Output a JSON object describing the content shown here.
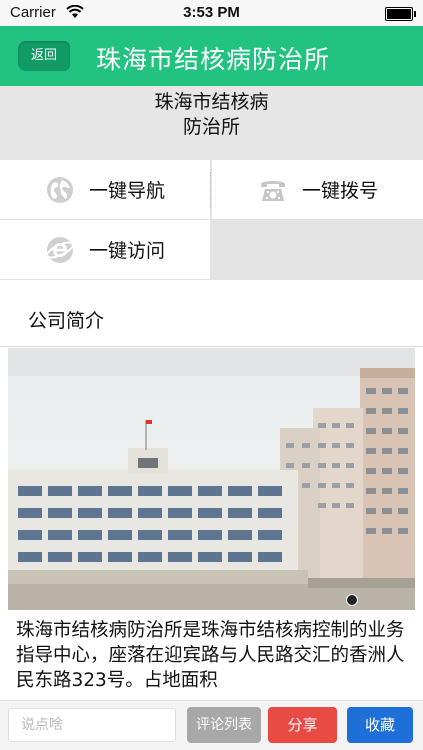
{
  "status_bar": {
    "carrier": "Carrier",
    "time": "3:53 PM"
  },
  "nav": {
    "back_label": "返回",
    "title": "珠海市结核病防治所"
  },
  "header": {
    "name_line1": "珠海市结核病",
    "name_line2": "防治所"
  },
  "actions": [
    {
      "label": "一键导航",
      "icon": "globe-icon"
    },
    {
      "label": "一键拨号",
      "icon": "phone-icon"
    },
    {
      "label": "一键访问",
      "icon": "ie-browser-icon"
    }
  ],
  "section": {
    "title": "公司简介"
  },
  "description": "珠海市结核病防治所是珠海市结核病控制的业务指导中心，座落在迎宾路与人民路交汇的香洲人民东路323号。占地面积",
  "bottom_bar": {
    "comment_placeholder": "说点啥",
    "comment_value": "",
    "list_label": "评论列表",
    "share_label": "分享",
    "favorite_label": "收藏"
  },
  "colors": {
    "nav_bg": "#22c281",
    "back_btn": "#129a66",
    "share": "#e84a44",
    "favorite": "#1f6fd8",
    "list": "#a8a8a8"
  }
}
